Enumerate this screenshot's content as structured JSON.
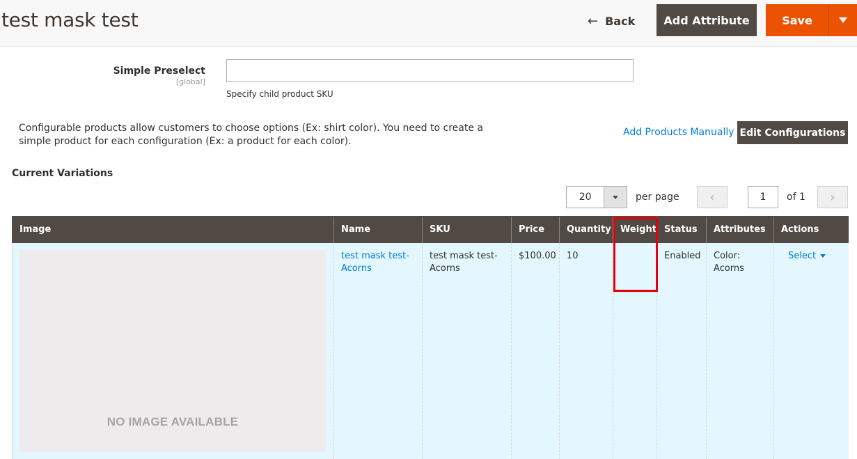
{
  "header": {
    "title": "test mask test",
    "back_label": "Back",
    "add_attribute_label": "Add Attribute",
    "save_label": "Save"
  },
  "simple_preselect": {
    "label": "Simple Preselect",
    "scope": "[global]",
    "value": "",
    "note": "Specify child product SKU"
  },
  "configurations": {
    "info_text": "Configurable products allow customers to choose options (Ex: shirt color). You need to create a simple product for each configuration (Ex: a product for each color).",
    "add_manually_label": "Add Products Manually",
    "edit_config_label": "Edit Configurations",
    "section_title": "Current Variations"
  },
  "pager": {
    "per_page_value": "20",
    "per_page_label": "per page",
    "current_page": "1",
    "of_label": "of 1",
    "prev_icon": "chevron-left",
    "next_icon": "chevron-right"
  },
  "table": {
    "columns": [
      "Image",
      "Name",
      "SKU",
      "Price",
      "Quantity",
      "Weight",
      "Status",
      "Attributes",
      "Actions"
    ],
    "rows": [
      {
        "image_placeholder": "NO IMAGE AVAILABLE",
        "name": "test mask test-Acorns",
        "sku": "test mask test-Acorns",
        "price": "$100.00",
        "quantity": "10",
        "weight": "",
        "status": "Enabled",
        "attributes": "Color: Acorns",
        "action_label": "Select"
      }
    ]
  },
  "annotation": {
    "highlight_color": "#e8000b",
    "highlighted_column": "Weight"
  },
  "colors": {
    "accent_orange": "#eb5202",
    "dark_button": "#514943",
    "link_blue": "#007bdb",
    "row_bg": "#e5f7fe"
  }
}
